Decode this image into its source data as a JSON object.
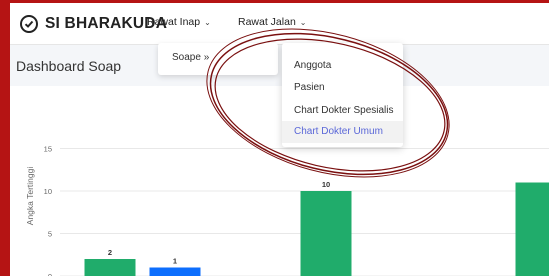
{
  "navbar": {
    "brand": "SI BHARAKUDA",
    "menu": [
      {
        "label": "Rawat Inap",
        "chevron": "⌄"
      },
      {
        "label": "Rawat Jalan",
        "chevron": "⌄"
      }
    ]
  },
  "submenu": {
    "soape_label": "Soape »"
  },
  "dropdown": {
    "items": [
      {
        "label": "Anggota"
      },
      {
        "label": "Pasien"
      },
      {
        "label": "Chart Dokter Spesialis"
      },
      {
        "label": "Chart Dokter Umum"
      }
    ],
    "active_color": "#5a67d8"
  },
  "page": {
    "title": "Dashboard Soap"
  },
  "chart_data": {
    "type": "bar",
    "ylabel": "Angka Tertinggi",
    "ylim": [
      0,
      15
    ],
    "yticks": [
      0,
      5,
      10,
      15
    ],
    "series": [
      {
        "color": "#20ac6b",
        "points": [
          {
            "slot": 0,
            "value": 2
          },
          {
            "slot": 2,
            "value": 10
          },
          {
            "slot": 3,
            "value": 11
          }
        ]
      },
      {
        "color": "#0d6efd",
        "points": [
          {
            "slot": 1,
            "value": 1
          }
        ]
      }
    ],
    "data_labels": [
      "2",
      "1",
      "10"
    ]
  },
  "colors": {
    "border": "#b51414",
    "green": "#20ac6b",
    "blue": "#0d6efd",
    "annotation": "#7a1010"
  },
  "icons": {
    "brand": "check-circle-icon"
  }
}
